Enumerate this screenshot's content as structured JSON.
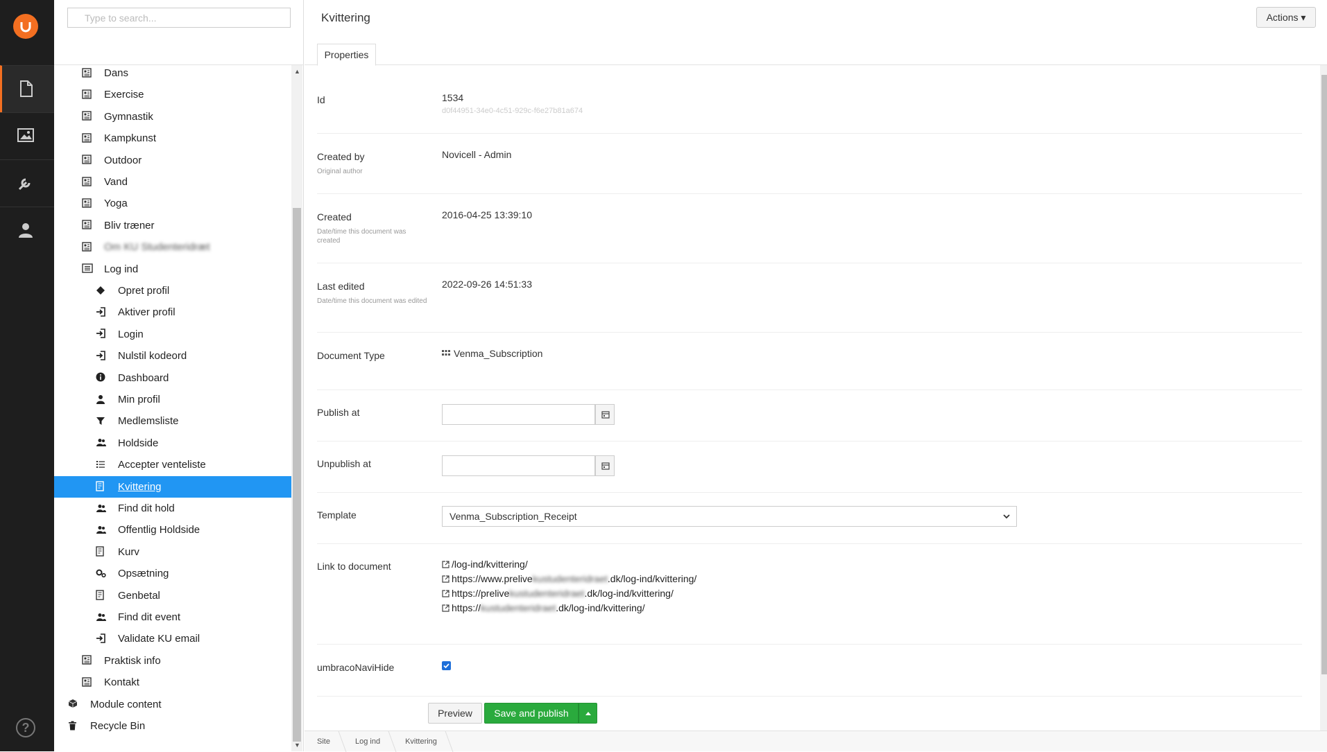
{
  "search": {
    "placeholder": "Type to search..."
  },
  "tree": {
    "items": [
      {
        "label": "Dans",
        "icon": "document-icon",
        "level": 1
      },
      {
        "label": "Exercise",
        "icon": "document-icon",
        "level": 1
      },
      {
        "label": "Gymnastik",
        "icon": "document-icon",
        "level": 1
      },
      {
        "label": "Kampkunst",
        "icon": "document-icon",
        "level": 1
      },
      {
        "label": "Outdoor",
        "icon": "document-icon",
        "level": 1
      },
      {
        "label": "Vand",
        "icon": "document-icon",
        "level": 1
      },
      {
        "label": "Yoga",
        "icon": "document-icon",
        "level": 1
      },
      {
        "label": "Bliv træner",
        "icon": "document-icon",
        "level": 1
      },
      {
        "label": "Om KU Studenteridræt",
        "icon": "document-icon",
        "level": 1,
        "blurred": true
      },
      {
        "label": "Log ind",
        "icon": "list-document-icon",
        "level": 1
      },
      {
        "label": "Opret profil",
        "icon": "diamond-icon",
        "level": 2
      },
      {
        "label": "Aktiver profil",
        "icon": "sign-in-icon",
        "level": 2
      },
      {
        "label": "Login",
        "icon": "sign-in-icon",
        "level": 2
      },
      {
        "label": "Nulstil kodeord",
        "icon": "sign-in-icon",
        "level": 2
      },
      {
        "label": "Dashboard",
        "icon": "info-icon",
        "level": 2
      },
      {
        "label": "Min profil",
        "icon": "user-icon",
        "level": 2
      },
      {
        "label": "Medlemsliste",
        "icon": "filter-icon",
        "level": 2
      },
      {
        "label": "Holdside",
        "icon": "users-icon",
        "level": 2
      },
      {
        "label": "Accepter venteliste",
        "icon": "list-icon",
        "level": 2
      },
      {
        "label": "Kvittering",
        "icon": "receipt-icon",
        "level": 2,
        "selected": true
      },
      {
        "label": "Find dit hold",
        "icon": "users-icon",
        "level": 2
      },
      {
        "label": "Offentlig Holdside",
        "icon": "users-icon",
        "level": 2
      },
      {
        "label": "Kurv",
        "icon": "receipt-icon",
        "level": 2
      },
      {
        "label": "Opsætning",
        "icon": "gears-icon",
        "level": 2
      },
      {
        "label": "Genbetal",
        "icon": "receipt-icon",
        "level": 2
      },
      {
        "label": "Find dit event",
        "icon": "users-icon",
        "level": 2
      },
      {
        "label": "Validate KU email",
        "icon": "sign-in-icon",
        "level": 2
      },
      {
        "label": "Praktisk info",
        "icon": "document-icon",
        "level": 1
      },
      {
        "label": "Kontakt",
        "icon": "document-icon",
        "level": 1
      },
      {
        "label": "Module content",
        "icon": "cube-icon",
        "level": 0
      },
      {
        "label": "Recycle Bin",
        "icon": "trash-icon",
        "level": 0
      }
    ]
  },
  "header": {
    "title": "Kvittering",
    "actions_label": "Actions ▾"
  },
  "tabs": [
    {
      "label": "Properties"
    }
  ],
  "properties": {
    "id": {
      "label": "Id",
      "value": "1534",
      "guid": "d0f44951-34e0-4c51-929c-f6e27b81a674"
    },
    "created_by": {
      "label": "Created by",
      "desc": "Original author",
      "value": "Novicell - Admin"
    },
    "created": {
      "label": "Created",
      "desc": "Date/time this document was created",
      "value": "2016-04-25 13:39:10"
    },
    "last_edited": {
      "label": "Last edited",
      "desc": "Date/time this document was edited",
      "value": "2022-09-26 14:51:33"
    },
    "document_type": {
      "label": "Document Type",
      "value": "Venma_Subscription"
    },
    "publish_at": {
      "label": "Publish at",
      "value": ""
    },
    "unpublish_at": {
      "label": "Unpublish at",
      "value": ""
    },
    "template": {
      "label": "Template",
      "value": "Venma_Subscription_Receipt"
    },
    "link_to_document": {
      "label": "Link to document",
      "links": [
        {
          "pre": "/log-ind/kvittering/",
          "blur": "",
          "post": ""
        },
        {
          "pre": "https://www.prelive",
          "blur": "kustudenteridraet",
          "post": ".dk/log-ind/kvittering/"
        },
        {
          "pre": "https://prelive",
          "blur": "kustudenteridraet",
          "post": ".dk/log-ind/kvittering/"
        },
        {
          "pre": "https://",
          "blur": "kustudenteridraet",
          "post": ".dk/log-ind/kvittering/"
        }
      ]
    },
    "navi_hide": {
      "label": "umbracoNaviHide",
      "checked": true
    }
  },
  "buttons": {
    "preview": "Preview",
    "save_publish": "Save and publish"
  },
  "breadcrumb": [
    "Site",
    "Log ind",
    "Kvittering"
  ],
  "colors": {
    "accent": "#f36f21",
    "selected": "#2196f3",
    "save": "#2aaa3d"
  }
}
